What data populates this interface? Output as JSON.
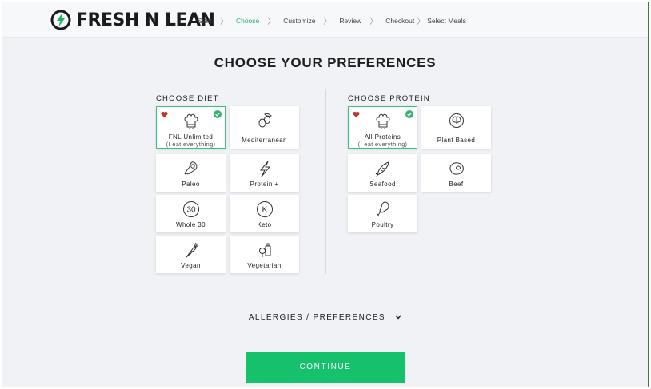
{
  "brand": {
    "name": "FRESH N LEAN",
    "accent": "#16c16b"
  },
  "steps": [
    {
      "label": "Start",
      "active": false
    },
    {
      "label": "Choose",
      "active": true
    },
    {
      "label": "Customize",
      "active": false
    },
    {
      "label": "Review",
      "active": false
    },
    {
      "label": "Checkout",
      "active": false
    },
    {
      "label": "Select Meals",
      "active": false
    }
  ],
  "page_title": "CHOOSE YOUR PREFERENCES",
  "diet": {
    "label": "CHOOSE DIET",
    "options": [
      {
        "label": "FNL Unlimited",
        "sub": "(I eat everything)",
        "icon": "chef-hat-icon",
        "selected": true,
        "favorite": true
      },
      {
        "label": "Mediterranean",
        "icon": "olive-icon",
        "selected": false
      },
      {
        "label": "Paleo",
        "icon": "meat-leg-icon",
        "selected": false
      },
      {
        "label": "Protein +",
        "icon": "lightning-icon",
        "selected": false
      },
      {
        "label": "Whole 30",
        "icon": "circle-30-icon",
        "glyph": "30",
        "selected": false
      },
      {
        "label": "Keto",
        "icon": "circle-k-icon",
        "glyph": "K",
        "selected": false
      },
      {
        "label": "Vegan",
        "icon": "carrot-icon",
        "selected": false
      },
      {
        "label": "Vegetarian",
        "icon": "vegetables-icon",
        "selected": false
      }
    ]
  },
  "protein": {
    "label": "CHOOSE PROTEIN",
    "options": [
      {
        "label": "All Proteins",
        "sub": "(I eat everything)",
        "icon": "chef-hat-icon",
        "selected": true,
        "favorite": true
      },
      {
        "label": "Plant Based",
        "icon": "cabbage-icon",
        "selected": false
      },
      {
        "label": "Seafood",
        "icon": "fish-icon",
        "selected": false
      },
      {
        "label": "Beef",
        "icon": "steak-icon",
        "selected": false
      },
      {
        "label": "Poultry",
        "icon": "drumstick-icon",
        "selected": false
      }
    ]
  },
  "allergies_label": "ALLERGIES / PREFERENCES",
  "continue_label": "CONTINUE"
}
